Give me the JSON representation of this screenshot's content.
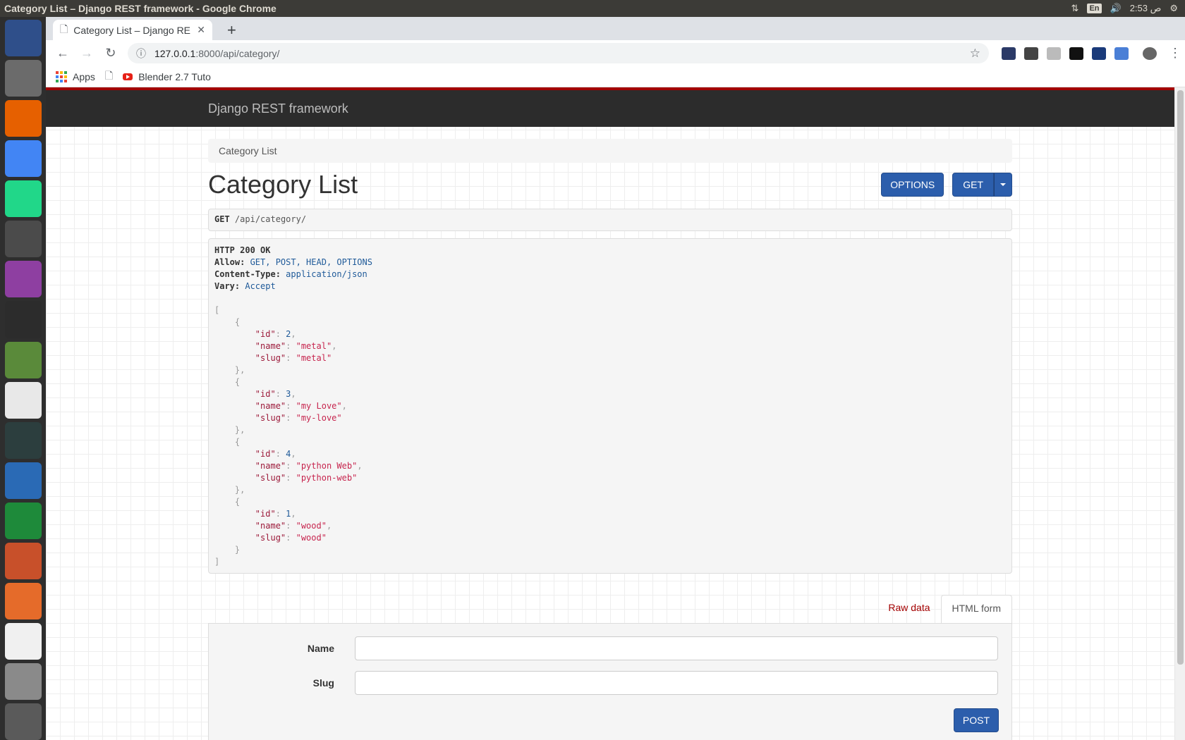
{
  "os": {
    "window_title": "Category List – Django REST framework - Google Chrome",
    "clock": "2:53 ص",
    "lang": "En"
  },
  "launcher": {
    "apps": [
      {
        "name": "ubuntu-dash-icon",
        "color": "#2f4f8a"
      },
      {
        "name": "files-icon",
        "color": "#6b6b6b"
      },
      {
        "name": "firefox-icon",
        "color": "#e66000"
      },
      {
        "name": "chrome-icon",
        "color": "#4285f4"
      },
      {
        "name": "pycharm-icon",
        "color": "#21d789"
      },
      {
        "name": "sublime-icon",
        "color": "#4b4b4b"
      },
      {
        "name": "app-window-icon",
        "color": "#8e3fa1"
      },
      {
        "name": "terminal-icon",
        "color": "#2c2c2c"
      },
      {
        "name": "image-viewer-icon",
        "color": "#5a8a3a"
      },
      {
        "name": "pdf-viewer-icon",
        "color": "#e8e8e8"
      },
      {
        "name": "system-monitor-icon",
        "color": "#2c3e3e"
      },
      {
        "name": "writer-icon",
        "color": "#2a6ab5"
      },
      {
        "name": "calc-icon",
        "color": "#1e8a3a"
      },
      {
        "name": "impress-icon",
        "color": "#c8502a"
      },
      {
        "name": "software-center-icon",
        "color": "#e56b2a"
      },
      {
        "name": "amazon-icon",
        "color": "#f0f0f0"
      },
      {
        "name": "install-icon",
        "color": "#8a8a8a"
      },
      {
        "name": "trash-icon",
        "color": "#5a5a5a"
      }
    ]
  },
  "browser": {
    "tab_title": "Category List – Django RE",
    "url_host": "127.0.0.1",
    "url_rest": ":8000/api/category/",
    "bookmarks": {
      "apps_label": "Apps",
      "blender_label": "Blender 2.7 Tuto"
    }
  },
  "drf": {
    "brand": "Django REST framework",
    "breadcrumb": "Category List",
    "title": "Category List",
    "options_label": "OPTIONS",
    "get_label": "GET",
    "request_method": "GET",
    "request_path": "/api/category/",
    "response": {
      "status": "HTTP 200 OK",
      "headers": [
        {
          "key": "Allow:",
          "value": "GET, POST, HEAD, OPTIONS"
        },
        {
          "key": "Content-Type:",
          "value": "application/json"
        },
        {
          "key": "Vary:",
          "value": "Accept"
        }
      ],
      "items": [
        {
          "id": 2,
          "name": "metal",
          "slug": "metal"
        },
        {
          "id": 3,
          "name": "my Love",
          "slug": "my-love"
        },
        {
          "id": 4,
          "name": "python Web",
          "slug": "python-web"
        },
        {
          "id": 1,
          "name": "wood",
          "slug": "wood"
        }
      ]
    },
    "tabs": {
      "raw": "Raw data",
      "html": "HTML form"
    },
    "form": {
      "name_label": "Name",
      "slug_label": "Slug",
      "post_label": "POST"
    }
  }
}
